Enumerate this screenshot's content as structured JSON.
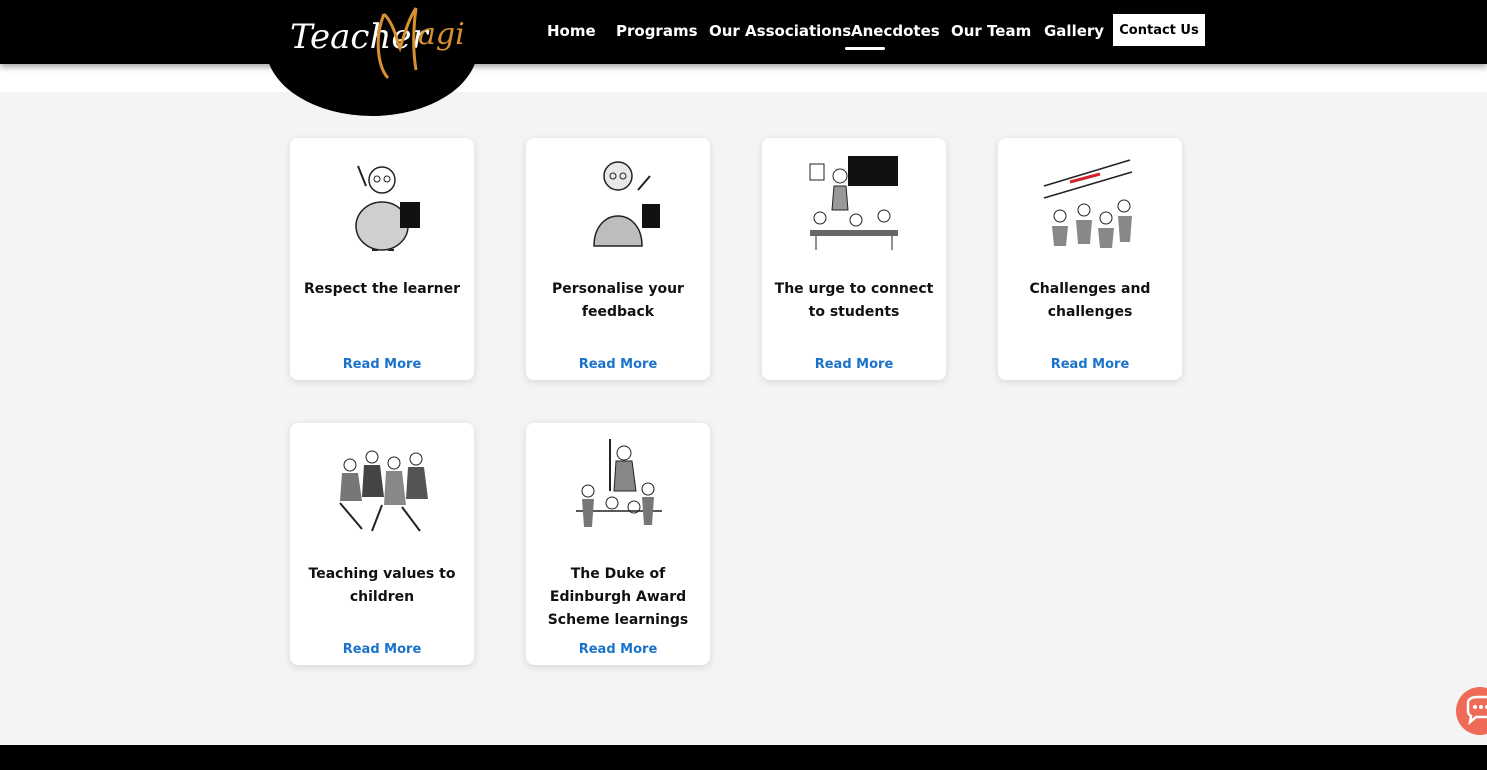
{
  "brand": {
    "logo_text": "TeacherMagi",
    "colors": {
      "header_bg": "#000000",
      "accent_link": "#1a73c9",
      "chat_button": "#ee6b57",
      "page_bg": "#f4f4f4"
    }
  },
  "nav": {
    "items": [
      {
        "label": "Home"
      },
      {
        "label": "Programs"
      },
      {
        "label": "Our Associations"
      },
      {
        "label": "Anecdotes",
        "active": true
      },
      {
        "label": "Our Team"
      },
      {
        "label": "Gallery"
      }
    ],
    "contact_label": "Contact Us"
  },
  "cards": [
    {
      "title": "Respect the learner",
      "link": "Read More",
      "image": "teacher-with-book-cartoon"
    },
    {
      "title": "Personalise your feedback",
      "link": "Read More",
      "image": "teacher-in-saree-cartoon"
    },
    {
      "title": "The urge to connect to students",
      "link": "Read More",
      "image": "classroom-teacher-cartoon"
    },
    {
      "title": "Challenges and challenges",
      "link": "Read More",
      "image": "we-now-love-maths-cartoon"
    },
    {
      "title": "Teaching values to children",
      "link": "Read More",
      "image": "children-playing-cartoon"
    },
    {
      "title": "The Duke of Edinburgh Award Scheme learnings",
      "link": "Read More",
      "image": "outdoor-group-cartoon"
    }
  ],
  "chat": {
    "icon": "chat-bubble-icon"
  }
}
